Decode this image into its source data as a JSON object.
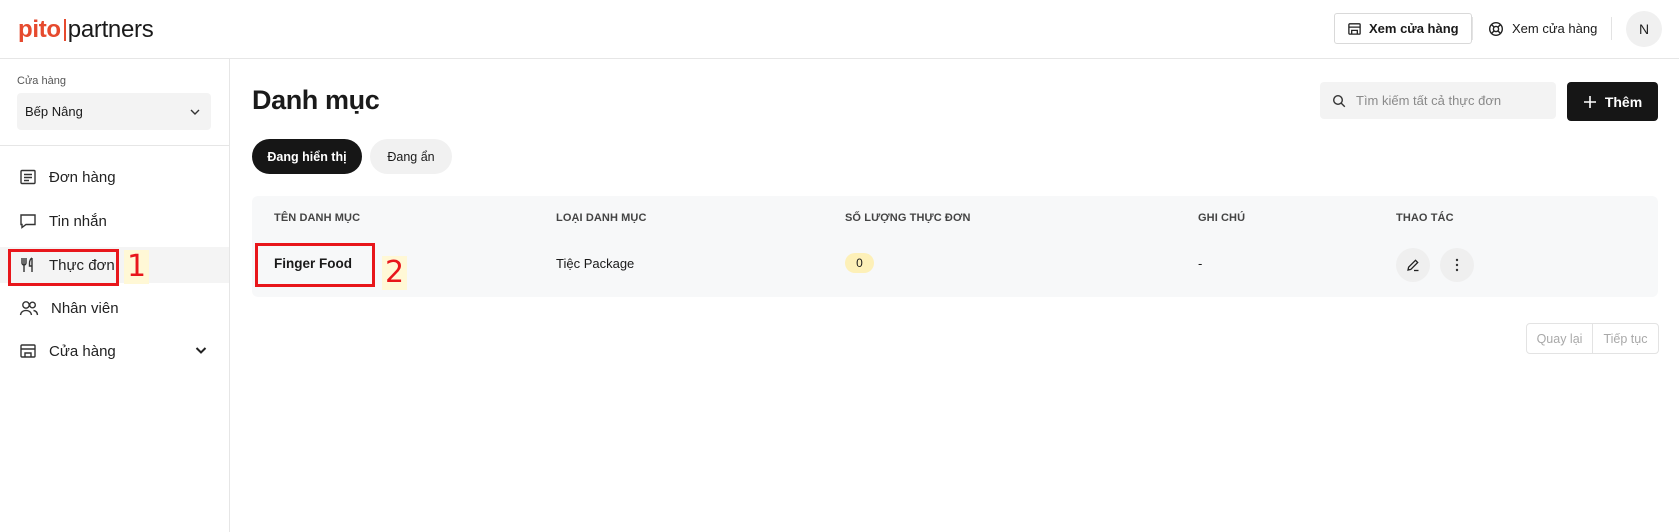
{
  "header": {
    "logo_brand": "pito",
    "logo_word": "partners",
    "view_store_button": "Xem cửa hàng",
    "view_store_link": "Xem cửa hàng",
    "avatar_initial": "N"
  },
  "sidebar": {
    "store_label": "Cửa hàng",
    "store_value": "Bếp Nâng",
    "items": [
      {
        "label": "Đơn hàng",
        "icon": "receipt-icon"
      },
      {
        "label": "Tin nhắn",
        "icon": "chat-icon"
      },
      {
        "label": "Thực đơn",
        "icon": "fork-knife-icon",
        "active": true
      },
      {
        "label": "Nhân viên",
        "icon": "users-icon"
      },
      {
        "label": "Cửa hàng",
        "icon": "store-icon",
        "expandable": true
      }
    ]
  },
  "annotations": {
    "first": "1",
    "second": "2",
    "color": "#e8161b"
  },
  "main": {
    "title": "Danh mục",
    "search_placeholder": "Tìm kiếm tất cả thực đơn",
    "add_button": "Thêm",
    "tabs": [
      {
        "label": "Đang hiển thị",
        "active": true
      },
      {
        "label": "Đang ẩn",
        "active": false
      }
    ],
    "table": {
      "headers": [
        "TÊN DANH MỤC",
        "LOẠI DANH MỤC",
        "SỐ LƯỢNG THỰC ĐƠN",
        "GHI CHÚ",
        "THAO TÁC"
      ],
      "rows": [
        {
          "name": "Finger Food",
          "type": "Tiệc Package",
          "count": "0",
          "note": "-"
        }
      ]
    },
    "pagination": {
      "prev": "Quay lại",
      "next": "Tiếp tục"
    }
  },
  "colors": {
    "brand": "#e64a2e",
    "primary_button": "#161616",
    "badge": "#fdf0b8"
  }
}
